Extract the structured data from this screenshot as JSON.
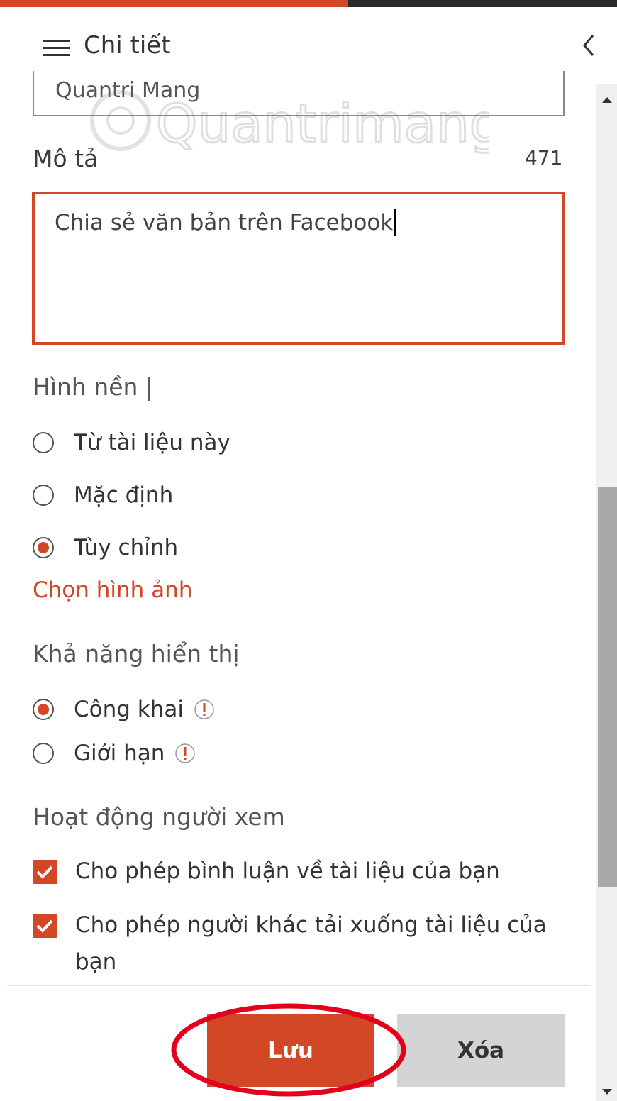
{
  "colors": {
    "accent": "#d24726",
    "highlight": "#e3001b"
  },
  "header": {
    "title": "Chi tiết",
    "menu_icon": "hamburger-icon",
    "collapse_icon": "chevron-left-icon"
  },
  "name_field": {
    "value": "Quantri Mang"
  },
  "watermark": {
    "text": "Quantrimang"
  },
  "description": {
    "label": "Mô tả",
    "remaining_count": "471",
    "value": "Chia sẻ văn bản trên Facebook"
  },
  "background": {
    "label": "Hình nền |",
    "options": [
      {
        "label": "Từ tài liệu này",
        "selected": false
      },
      {
        "label": "Mặc định",
        "selected": false
      },
      {
        "label": "Tùy chỉnh",
        "selected": true
      }
    ],
    "choose_image_link": "Chọn hình ảnh"
  },
  "visibility": {
    "label": "Khả năng hiển thị",
    "options": [
      {
        "label": "Công khai",
        "selected": true,
        "info_icon": "info-icon"
      },
      {
        "label": "Giới hạn",
        "selected": false,
        "info_icon": "info-icon"
      }
    ]
  },
  "viewer_activity": {
    "label": "Hoạt động người xem",
    "options": [
      {
        "label": "Cho phép bình luận về tài liệu của bạn",
        "checked": true
      },
      {
        "label": "Cho phép người khác tải xuống tài liệu của bạn",
        "checked": true
      }
    ]
  },
  "footer": {
    "save_label": "Lưu",
    "delete_label": "Xóa"
  }
}
